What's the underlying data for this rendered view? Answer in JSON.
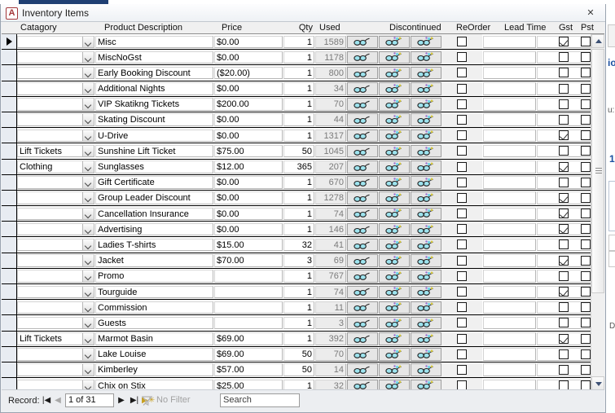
{
  "window": {
    "title": "Inventory Items",
    "app_icon": "access-icon",
    "app_icon_letter": "A",
    "close_label": "✕",
    "close_icon": "close-icon"
  },
  "columns": [
    {
      "key": "category",
      "label": "Catagory"
    },
    {
      "key": "product",
      "label": "Product Description"
    },
    {
      "key": "price",
      "label": "Price"
    },
    {
      "key": "qty",
      "label": "Qty"
    },
    {
      "key": "used",
      "label": "Used"
    },
    {
      "key": "discontinued",
      "label": "Discontinued"
    },
    {
      "key": "reorder",
      "label": "ReOrder"
    },
    {
      "key": "leadtime",
      "label": "Lead Time"
    },
    {
      "key": "gst",
      "label": "Gst"
    },
    {
      "key": "pst",
      "label": "Pst"
    }
  ],
  "rows": [
    {
      "category": "",
      "product": "Misc",
      "price": "$0.00",
      "qty": "1",
      "used": "1589",
      "discontinued": false,
      "reorder": "",
      "leadtime": "",
      "gst": true,
      "pst": false,
      "current": true
    },
    {
      "category": "",
      "product": "MiscNoGst",
      "price": "$0.00",
      "qty": "1",
      "used": "1178",
      "discontinued": false,
      "reorder": "",
      "leadtime": "",
      "gst": false,
      "pst": false,
      "current": false
    },
    {
      "category": "",
      "product": "Early Booking Discount",
      "price": "($20.00)",
      "qty": "1",
      "used": "800",
      "discontinued": false,
      "reorder": "",
      "leadtime": "",
      "gst": false,
      "pst": false,
      "current": false
    },
    {
      "category": "",
      "product": "Additional Nights",
      "price": "$0.00",
      "qty": "1",
      "used": "34",
      "discontinued": false,
      "reorder": "",
      "leadtime": "",
      "gst": false,
      "pst": false,
      "current": false
    },
    {
      "category": "",
      "product": "VIP Skatikng Tickets",
      "price": "$200.00",
      "qty": "1",
      "used": "70",
      "discontinued": false,
      "reorder": "",
      "leadtime": "",
      "gst": false,
      "pst": false,
      "current": false
    },
    {
      "category": "",
      "product": "Skating Discount",
      "price": "$0.00",
      "qty": "1",
      "used": "44",
      "discontinued": false,
      "reorder": "",
      "leadtime": "",
      "gst": false,
      "pst": false,
      "current": false
    },
    {
      "category": "",
      "product": "U-Drive",
      "price": "$0.00",
      "qty": "1",
      "used": "1317",
      "discontinued": false,
      "reorder": "",
      "leadtime": "",
      "gst": true,
      "pst": false,
      "current": false
    },
    {
      "category": "Lift Tickets",
      "product": "Sunshine Lift Ticket",
      "price": "$75.00",
      "qty": "50",
      "used": "1045",
      "discontinued": false,
      "reorder": "",
      "leadtime": "",
      "gst": false,
      "pst": false,
      "current": false
    },
    {
      "category": "Clothing",
      "product": "Sunglasses",
      "price": "$12.00",
      "qty": "365",
      "used": "207",
      "discontinued": false,
      "reorder": "",
      "leadtime": "",
      "gst": true,
      "pst": false,
      "current": false
    },
    {
      "category": "",
      "product": "Gift Certificate",
      "price": "$0.00",
      "qty": "1",
      "used": "670",
      "discontinued": false,
      "reorder": "",
      "leadtime": "",
      "gst": false,
      "pst": false,
      "current": false
    },
    {
      "category": "",
      "product": "Group Leader Discount",
      "price": "$0.00",
      "qty": "1",
      "used": "1278",
      "discontinued": false,
      "reorder": "",
      "leadtime": "",
      "gst": true,
      "pst": false,
      "current": false
    },
    {
      "category": "",
      "product": "Cancellation Insurance",
      "price": "$0.00",
      "qty": "1",
      "used": "74",
      "discontinued": false,
      "reorder": "",
      "leadtime": "",
      "gst": true,
      "pst": false,
      "current": false
    },
    {
      "category": "",
      "product": "Advertising",
      "price": "$0.00",
      "qty": "1",
      "used": "146",
      "discontinued": false,
      "reorder": "",
      "leadtime": "",
      "gst": true,
      "pst": false,
      "current": false
    },
    {
      "category": "",
      "product": "Ladies T-shirts",
      "price": "$15.00",
      "qty": "32",
      "used": "41",
      "discontinued": false,
      "reorder": "",
      "leadtime": "",
      "gst": false,
      "pst": false,
      "current": false
    },
    {
      "category": "",
      "product": "Jacket",
      "price": "$70.00",
      "qty": "3",
      "used": "69",
      "discontinued": false,
      "reorder": "",
      "leadtime": "",
      "gst": true,
      "pst": false,
      "current": false
    },
    {
      "category": "",
      "product": "Promo",
      "price": "",
      "qty": "1",
      "used": "767",
      "discontinued": false,
      "reorder": "",
      "leadtime": "",
      "gst": false,
      "pst": false,
      "current": false
    },
    {
      "category": "",
      "product": "Tourguide",
      "price": "",
      "qty": "1",
      "used": "74",
      "discontinued": false,
      "reorder": "",
      "leadtime": "",
      "gst": true,
      "pst": false,
      "current": false
    },
    {
      "category": "",
      "product": "Commission",
      "price": "",
      "qty": "1",
      "used": "11",
      "discontinued": false,
      "reorder": "",
      "leadtime": "",
      "gst": false,
      "pst": false,
      "current": false
    },
    {
      "category": "",
      "product": "Guests",
      "price": "",
      "qty": "1",
      "used": "3",
      "discontinued": false,
      "reorder": "",
      "leadtime": "",
      "gst": false,
      "pst": false,
      "current": false
    },
    {
      "category": "Lift Tickets",
      "product": "Marmot Basin",
      "price": "$69.00",
      "qty": "1",
      "used": "392",
      "discontinued": false,
      "reorder": "",
      "leadtime": "",
      "gst": true,
      "pst": false,
      "current": false
    },
    {
      "category": "",
      "product": "Lake Louise",
      "price": "$69.00",
      "qty": "50",
      "used": "70",
      "discontinued": false,
      "reorder": "",
      "leadtime": "",
      "gst": false,
      "pst": false,
      "current": false
    },
    {
      "category": "",
      "product": "Kimberley",
      "price": "$57.00",
      "qty": "50",
      "used": "14",
      "discontinued": false,
      "reorder": "",
      "leadtime": "",
      "gst": false,
      "pst": false,
      "current": false
    },
    {
      "category": "",
      "product": "Chix on Stix",
      "price": "$25.00",
      "qty": "1",
      "used": "32",
      "discontinued": false,
      "reorder": "",
      "leadtime": "",
      "gst": false,
      "pst": false,
      "current": false
    }
  ],
  "row_buttons": [
    {
      "name": "view-glasses-button",
      "icon": "glasses-icon"
    },
    {
      "name": "detail-glasses-button",
      "icon": "glasses-star-icon"
    },
    {
      "name": "more-glasses-button",
      "icon": "glasses-star-icon"
    }
  ],
  "navigation": {
    "record_label": "Record:",
    "first_label": "|◀",
    "prev_label": "◀",
    "position": "1 of 31",
    "next_label": "▶",
    "last_label": "▶|",
    "new_label": "▶✳",
    "filter_label": "No Filter",
    "filter_icon": "filter-icon",
    "search_value": "Search"
  },
  "scrollbar": {
    "up_icon": "scroll-up-arrow-icon",
    "down_icon": "scroll-down-arrow-icon",
    "thumb": "scroll-thumb"
  },
  "background": {
    "snippets": [
      "io",
      "u:",
      "1",
      "D"
    ]
  },
  "colors": {
    "accent": "#1f3f73",
    "app_icon": "#a4373a",
    "readonly_text": "#7a7a7a",
    "header_bg": "#f0f0f0"
  }
}
